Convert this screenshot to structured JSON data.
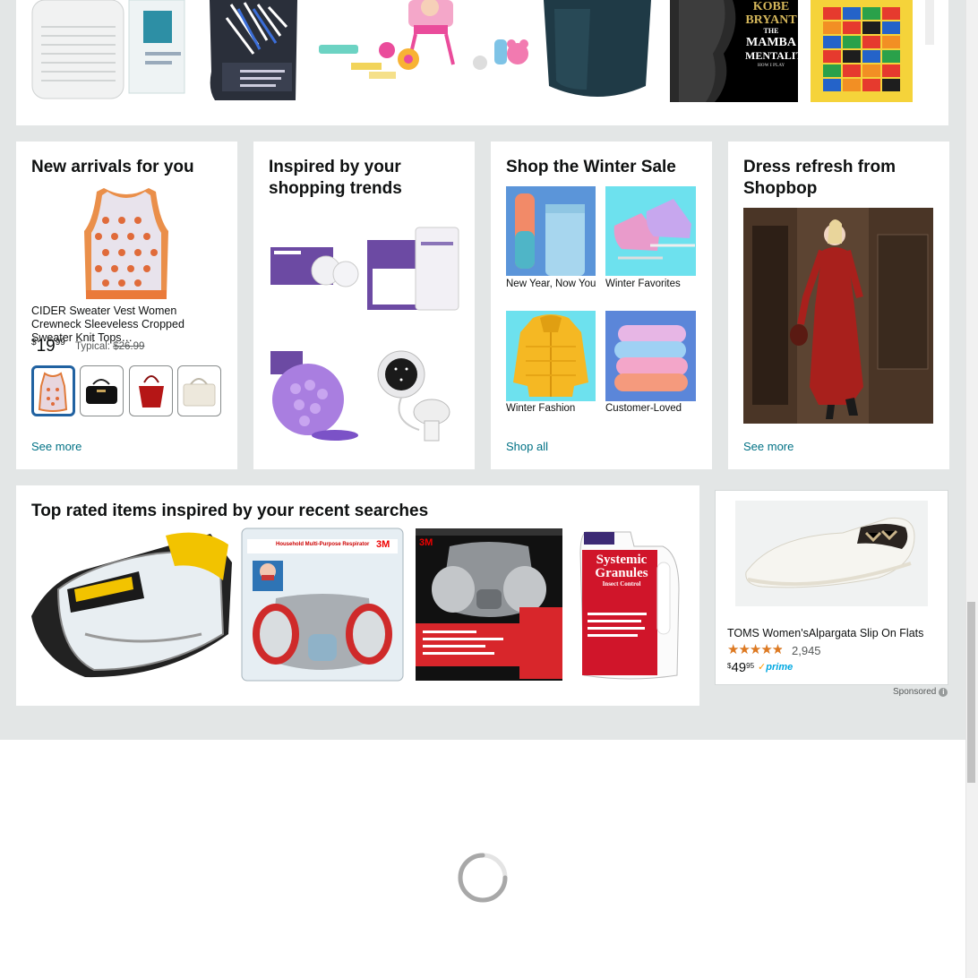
{
  "top_strip": {
    "items": [
      "air-purifier",
      "golf-tees",
      "doll-playset",
      "dark-vase",
      "book-cover",
      "lego-blanket"
    ],
    "book_title_lines": [
      "KOBE",
      "BRYANT",
      "THE",
      "MAMBA",
      "MENTALITY"
    ],
    "book_caption": "HOW I PLAY"
  },
  "new_arrivals": {
    "title": "New arrivals for you",
    "product_name": "CIDER Sweater Vest Women Crewneck Sleeveless Cropped Sweater Knit Tops…",
    "price_symbol": "$",
    "price_whole": "19",
    "price_fraction": "99",
    "typical_label": "Typical:",
    "typical_price": "$26.99",
    "see_more": "See more"
  },
  "inspired": {
    "title": "Inspired by your shopping trends"
  },
  "winter_sale": {
    "title": "Shop the Winter Sale",
    "tiles": [
      {
        "label": "New Year, Now You"
      },
      {
        "label": "Winter Favorites"
      },
      {
        "label": "Winter Fashion"
      },
      {
        "label": "Customer-Loved"
      }
    ],
    "shop_all": "Shop all"
  },
  "dress_refresh": {
    "title": "Dress refresh from Shopbop",
    "see_more": "See more"
  },
  "top_rated": {
    "title": "Top rated items inspired by your recent searches",
    "items": [
      "safety-goggles",
      "respirator-3m",
      "paint-respirator-3m",
      "systemic-granules"
    ],
    "respirator_label": "Household Multi-Purpose Respirator",
    "brand_3m": "3M",
    "granules_lines": [
      "Systemic",
      "Granules",
      "Insect Control"
    ]
  },
  "sponsored_ad": {
    "product_name": "TOMS Women'sAlpargata Slip On Flats",
    "rating_count": "2,945",
    "price_symbol": "$",
    "price_whole": "49",
    "price_fraction": "95",
    "prime_label": "prime",
    "sponsored_label": "Sponsored"
  },
  "colors": {
    "link": "#007185",
    "page_bg": "#e3e6e6",
    "star": "#de7921",
    "selected_swatch": "#2162a1"
  },
  "rating_stars": 4.5
}
